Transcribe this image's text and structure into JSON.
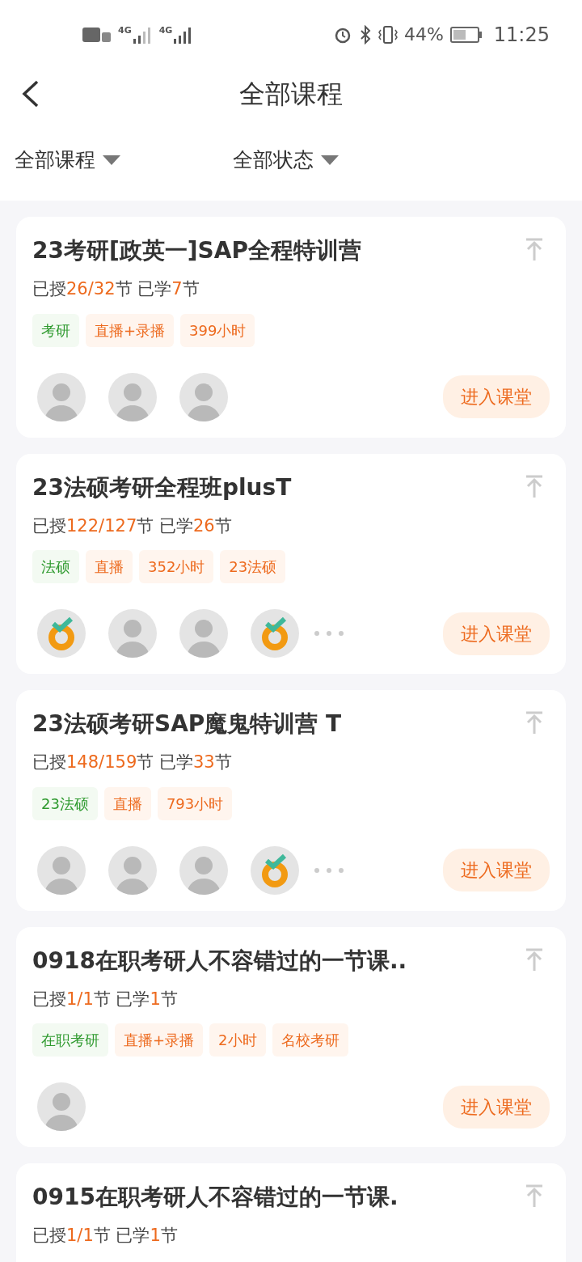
{
  "status_bar": {
    "network_1": "4G",
    "network_2": "4G",
    "battery": "44%",
    "time": "11:25"
  },
  "header": {
    "title": "全部课程"
  },
  "filters": [
    {
      "label": "全部课程"
    },
    {
      "label": "全部状态"
    }
  ],
  "courses": [
    {
      "title": "23考研[政英一]SAP全程特训营",
      "progress": [
        {
          "text": "已授",
          "kind": "plain"
        },
        {
          "text": "26/32",
          "kind": "accent"
        },
        {
          "text": "节 已学",
          "kind": "plain"
        },
        {
          "text": "7",
          "kind": "accent"
        },
        {
          "text": "节",
          "kind": "plain"
        }
      ],
      "tags": [
        {
          "label": "考研",
          "kind": "category"
        },
        {
          "label": "直播+录播",
          "kind": "info"
        },
        {
          "label": "399小时",
          "kind": "info"
        }
      ],
      "avatars": [
        {
          "kind": "photo"
        },
        {
          "kind": "photo"
        },
        {
          "kind": "photo"
        }
      ],
      "more": false,
      "button": "进入课堂"
    },
    {
      "title": "23法硕考研全程班plusT",
      "progress": [
        {
          "text": "已授",
          "kind": "plain"
        },
        {
          "text": "122/127",
          "kind": "accent"
        },
        {
          "text": "节 已学",
          "kind": "plain"
        },
        {
          "text": "26",
          "kind": "accent"
        },
        {
          "text": "节",
          "kind": "plain"
        }
      ],
      "tags": [
        {
          "label": "法硕",
          "kind": "category"
        },
        {
          "label": "直播",
          "kind": "info"
        },
        {
          "label": "352小时",
          "kind": "info"
        },
        {
          "label": "23法硕",
          "kind": "info"
        }
      ],
      "avatars": [
        {
          "kind": "logo"
        },
        {
          "kind": "photo"
        },
        {
          "kind": "photo"
        },
        {
          "kind": "logo"
        }
      ],
      "more": true,
      "button": "进入课堂"
    },
    {
      "title": "23法硕考研SAP魔鬼特训营 T",
      "progress": [
        {
          "text": "已授",
          "kind": "plain"
        },
        {
          "text": "148/159",
          "kind": "accent"
        },
        {
          "text": "节 已学",
          "kind": "plain"
        },
        {
          "text": "33",
          "kind": "accent"
        },
        {
          "text": "节",
          "kind": "plain"
        }
      ],
      "tags": [
        {
          "label": "23法硕",
          "kind": "category"
        },
        {
          "label": "直播",
          "kind": "info"
        },
        {
          "label": "793小时",
          "kind": "info"
        }
      ],
      "avatars": [
        {
          "kind": "photo"
        },
        {
          "kind": "photo"
        },
        {
          "kind": "photo"
        },
        {
          "kind": "logo"
        }
      ],
      "more": true,
      "button": "进入课堂"
    },
    {
      "title": "0918在职考研人不容错过的一节课..",
      "progress": [
        {
          "text": "已授",
          "kind": "plain"
        },
        {
          "text": "1/1",
          "kind": "accent"
        },
        {
          "text": "节 已学",
          "kind": "plain"
        },
        {
          "text": "1",
          "kind": "accent"
        },
        {
          "text": "节",
          "kind": "plain"
        }
      ],
      "tags": [
        {
          "label": "在职考研",
          "kind": "category"
        },
        {
          "label": "直播+录播",
          "kind": "info"
        },
        {
          "label": "2小时",
          "kind": "info"
        },
        {
          "label": "名校考研",
          "kind": "info"
        }
      ],
      "avatars": [
        {
          "kind": "photo"
        }
      ],
      "more": false,
      "button": "进入课堂"
    },
    {
      "title": "0915在职考研人不容错过的一节课.",
      "progress": [
        {
          "text": "已授",
          "kind": "plain"
        },
        {
          "text": "1/1",
          "kind": "accent"
        },
        {
          "text": "节 已学",
          "kind": "plain"
        },
        {
          "text": "1",
          "kind": "accent"
        },
        {
          "text": "节",
          "kind": "plain"
        }
      ]
    }
  ]
}
